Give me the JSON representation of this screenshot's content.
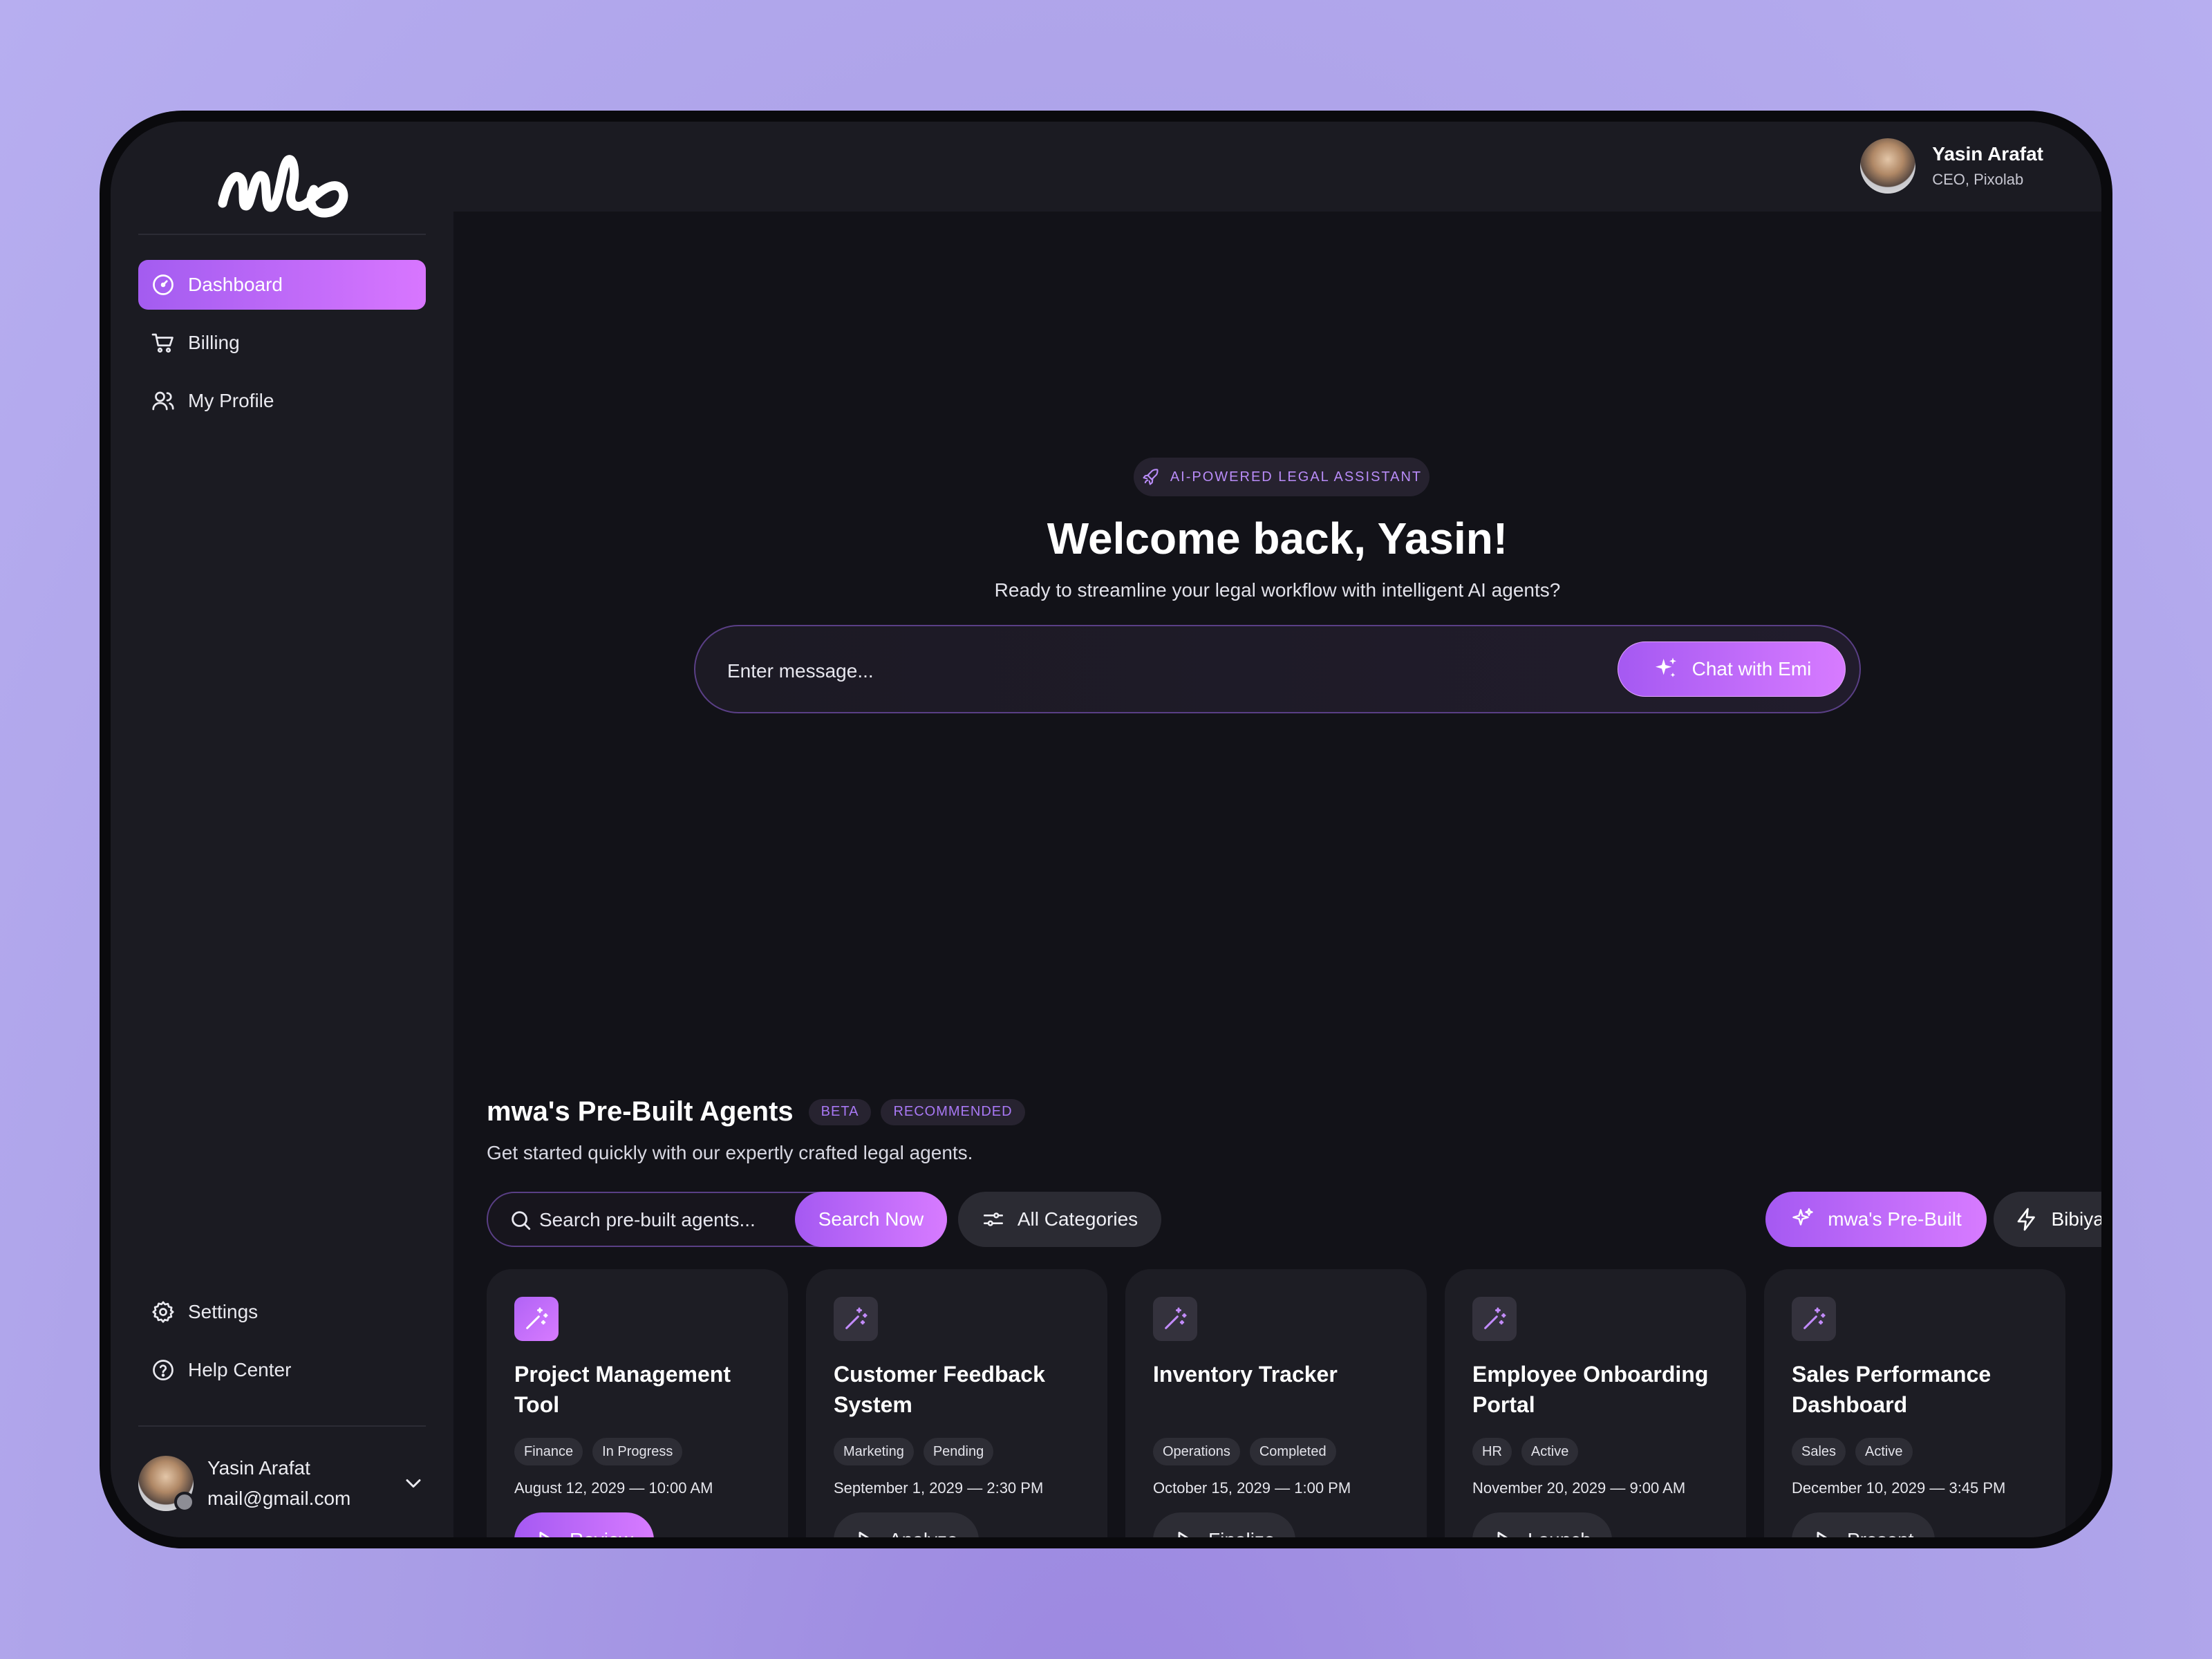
{
  "sidebar": {
    "logo_alt": "mw",
    "nav": [
      {
        "label": "Dashboard",
        "icon": "dashboard-icon",
        "active": true
      },
      {
        "label": "Billing",
        "icon": "cart-icon"
      },
      {
        "label": "My Profile",
        "icon": "users-icon"
      }
    ],
    "bottom_nav": [
      {
        "label": "Settings",
        "icon": "gear-icon"
      },
      {
        "label": "Help Center",
        "icon": "help-icon"
      }
    ],
    "user": {
      "name": "Yasin Arafat",
      "email": "mail@gmail.com"
    }
  },
  "header": {
    "user": {
      "name": "Yasin Arafat",
      "role": "CEO, Pixolab"
    }
  },
  "hero": {
    "badge": "AI-POWERED LEGAL ASSISTANT",
    "title": "Welcome back, Yasin!",
    "subtitle": "Ready to streamline your legal workflow with intelligent AI agents?",
    "message_placeholder": "Enter message...",
    "chat_button": "Chat with Emi"
  },
  "agents": {
    "title": "mwa's Pre-Built Agents",
    "badges": [
      "BETA",
      "RECOMMENDED"
    ],
    "subtitle": "Get started quickly with our expertly crafted legal agents.",
    "search_placeholder": "Search pre-built agents...",
    "search_button": "Search Now",
    "categories_button": "All Categories",
    "toggles": [
      {
        "label": "mwa's Pre-Built",
        "active": true
      },
      {
        "label": "Bibiyan Law",
        "active": false
      }
    ],
    "cards": [
      {
        "title": "Project Management Tool",
        "tags": [
          "Finance",
          "In Progress"
        ],
        "date": "August 12, 2029 — 10:00 AM",
        "action": "Review",
        "active": true
      },
      {
        "title": "Customer Feedback System",
        "tags": [
          "Marketing",
          "Pending"
        ],
        "date": "September 1, 2029 — 2:30 PM",
        "action": "Analyze",
        "active": false
      },
      {
        "title": "Inventory Tracker",
        "tags": [
          "Operations",
          "Completed"
        ],
        "date": "October 15, 2029 — 1:00 PM",
        "action": "Finalize",
        "active": false
      },
      {
        "title": "Employee Onboarding Portal",
        "tags": [
          "HR",
          "Active"
        ],
        "date": "November 20, 2029 — 9:00 AM",
        "action": "Launch",
        "active": false
      },
      {
        "title": "Sales Performance Dashboard",
        "tags": [
          "Sales",
          "Active"
        ],
        "date": "December 10, 2029 — 3:45 PM",
        "action": "Present",
        "active": false
      }
    ]
  },
  "colors": {
    "accent_start": "#a559f2",
    "accent_end": "#d77bff",
    "background": "#121218",
    "panel": "#1b1b22"
  }
}
